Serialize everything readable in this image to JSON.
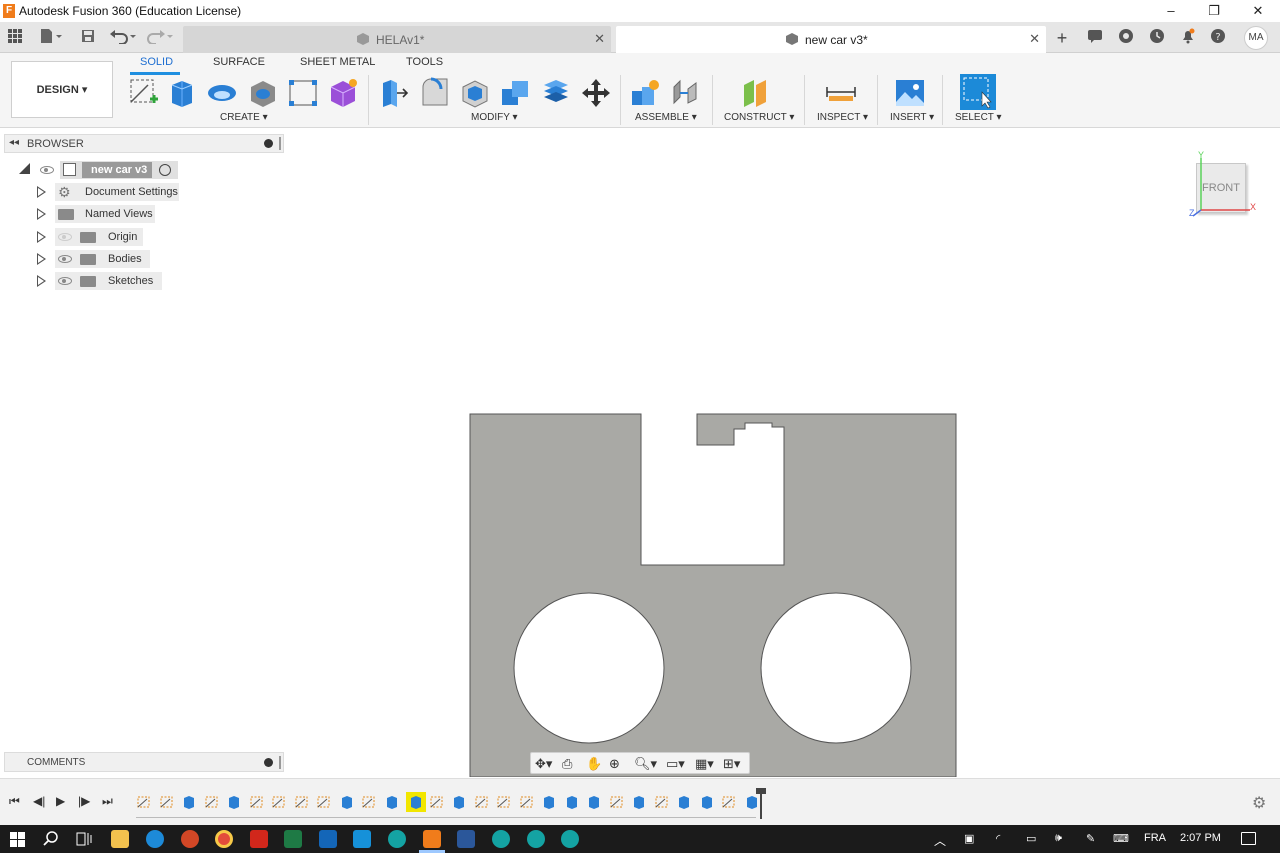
{
  "window": {
    "title": "Autodesk Fusion 360 (Education License)",
    "minimize": "–",
    "restore": "❐",
    "close": "✕"
  },
  "tabs": [
    {
      "label": "HELAv1*",
      "active": false
    },
    {
      "label": "new car v3*",
      "active": true
    }
  ],
  "tabbar": {
    "user_initials": "MA",
    "new_tab": "+"
  },
  "toolbar": {
    "design_label": "DESIGN ▾",
    "workspace_tabs": [
      "SOLID",
      "SURFACE",
      "SHEET METAL",
      "TOOLS"
    ],
    "groups": [
      "CREATE ▾",
      "MODIFY ▾",
      "ASSEMBLE ▾",
      "CONSTRUCT ▾",
      "INSPECT ▾",
      "INSERT ▾",
      "SELECT ▾"
    ]
  },
  "browser": {
    "title": "BROWSER",
    "root": "new car v3",
    "items": [
      "Document Settings",
      "Named Views",
      "Origin",
      "Bodies",
      "Sketches"
    ]
  },
  "comments": {
    "title": "COMMENTS"
  },
  "viewcube": {
    "face": "FRONT",
    "axis_y": "Y",
    "axis_x": "X",
    "axis_z": "Z"
  },
  "taskbar": {
    "language": "FRA",
    "time": "2:07 PM"
  },
  "colors": {
    "accent": "#1f8fe0",
    "part_fill": "#a9a9a5",
    "taskbar": "#1b1b1b",
    "highlight": "#f2e600"
  }
}
